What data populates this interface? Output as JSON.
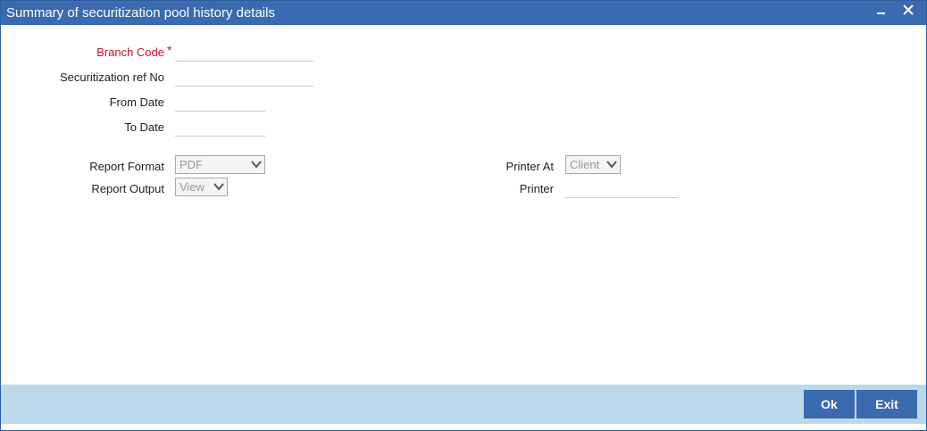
{
  "window": {
    "title": "Summary of securitization pool history details"
  },
  "form": {
    "branch_code": {
      "label": "Branch Code",
      "required_mark": "*",
      "value": ""
    },
    "securitization_ref_no": {
      "label": "Securitization ref No",
      "value": ""
    },
    "from_date": {
      "label": "From Date",
      "value": ""
    },
    "to_date": {
      "label": "To Date",
      "value": ""
    },
    "report_format": {
      "label": "Report Format",
      "selected": "PDF"
    },
    "report_output": {
      "label": "Report Output",
      "selected": "View"
    },
    "printer_at": {
      "label": "Printer At",
      "selected": "Client"
    },
    "printer": {
      "label": "Printer",
      "value": ""
    }
  },
  "footer": {
    "ok_label": "Ok",
    "exit_label": "Exit"
  },
  "colors": {
    "titlebar": "#3a6ab0",
    "footer": "#bcd9ec",
    "required": "#c8102e",
    "button": "#3a6ab0"
  },
  "icons": {
    "minimize": "minimize-icon",
    "close": "close-icon",
    "dropdown": "chevron-down-icon"
  }
}
